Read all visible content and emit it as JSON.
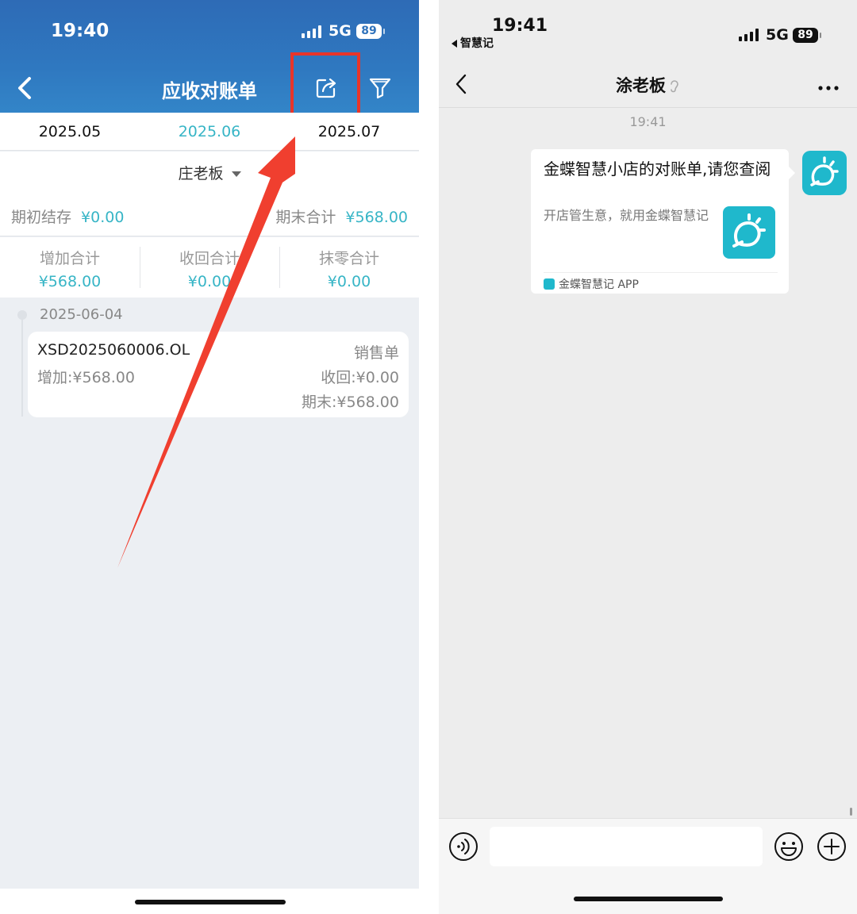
{
  "left": {
    "status": {
      "time": "19:40",
      "network": "5G",
      "battery": "89"
    },
    "header": {
      "title": "应收对账单"
    },
    "month_tabs": [
      {
        "label": "2025.05",
        "active": false
      },
      {
        "label": "2025.06",
        "active": true
      },
      {
        "label": "2025.07",
        "active": false
      }
    ],
    "customer": "庄老板",
    "opening": {
      "label": "期初结存",
      "value": "¥0.00"
    },
    "closing": {
      "label": "期末合计",
      "value": "¥568.00"
    },
    "summary": [
      {
        "label": "增加合计",
        "value": "¥568.00"
      },
      {
        "label": "收回合计",
        "value": "¥0.00"
      },
      {
        "label": "抹零合计",
        "value": "¥0.00"
      }
    ],
    "timeline": {
      "date": "2025-06-04",
      "record": {
        "number": "XSD2025060006.OL",
        "type": "销售单",
        "increase": "增加:¥568.00",
        "received": "收回:¥0.00",
        "ending": "期末:¥568.00"
      }
    },
    "annotation_color": "#e8352a",
    "accent_color": "#37b5c6",
    "header_color": "#2f72bb"
  },
  "right": {
    "status": {
      "time": "19:41",
      "back_app": "智慧记",
      "network": "5G",
      "battery": "89"
    },
    "chat": {
      "title": "涂老板"
    },
    "message": {
      "time": "19:41",
      "card_title": "金蝶智慧小店的对账单,请您查阅",
      "card_desc": "开店管生意，就用金蝶智慧记",
      "card_source": "金蝶智慧记 APP"
    },
    "input": {
      "placeholder": ""
    },
    "icons": [
      "voice-icon",
      "emoji-icon",
      "plus-icon",
      "more-icon",
      "mute-icon"
    ]
  }
}
